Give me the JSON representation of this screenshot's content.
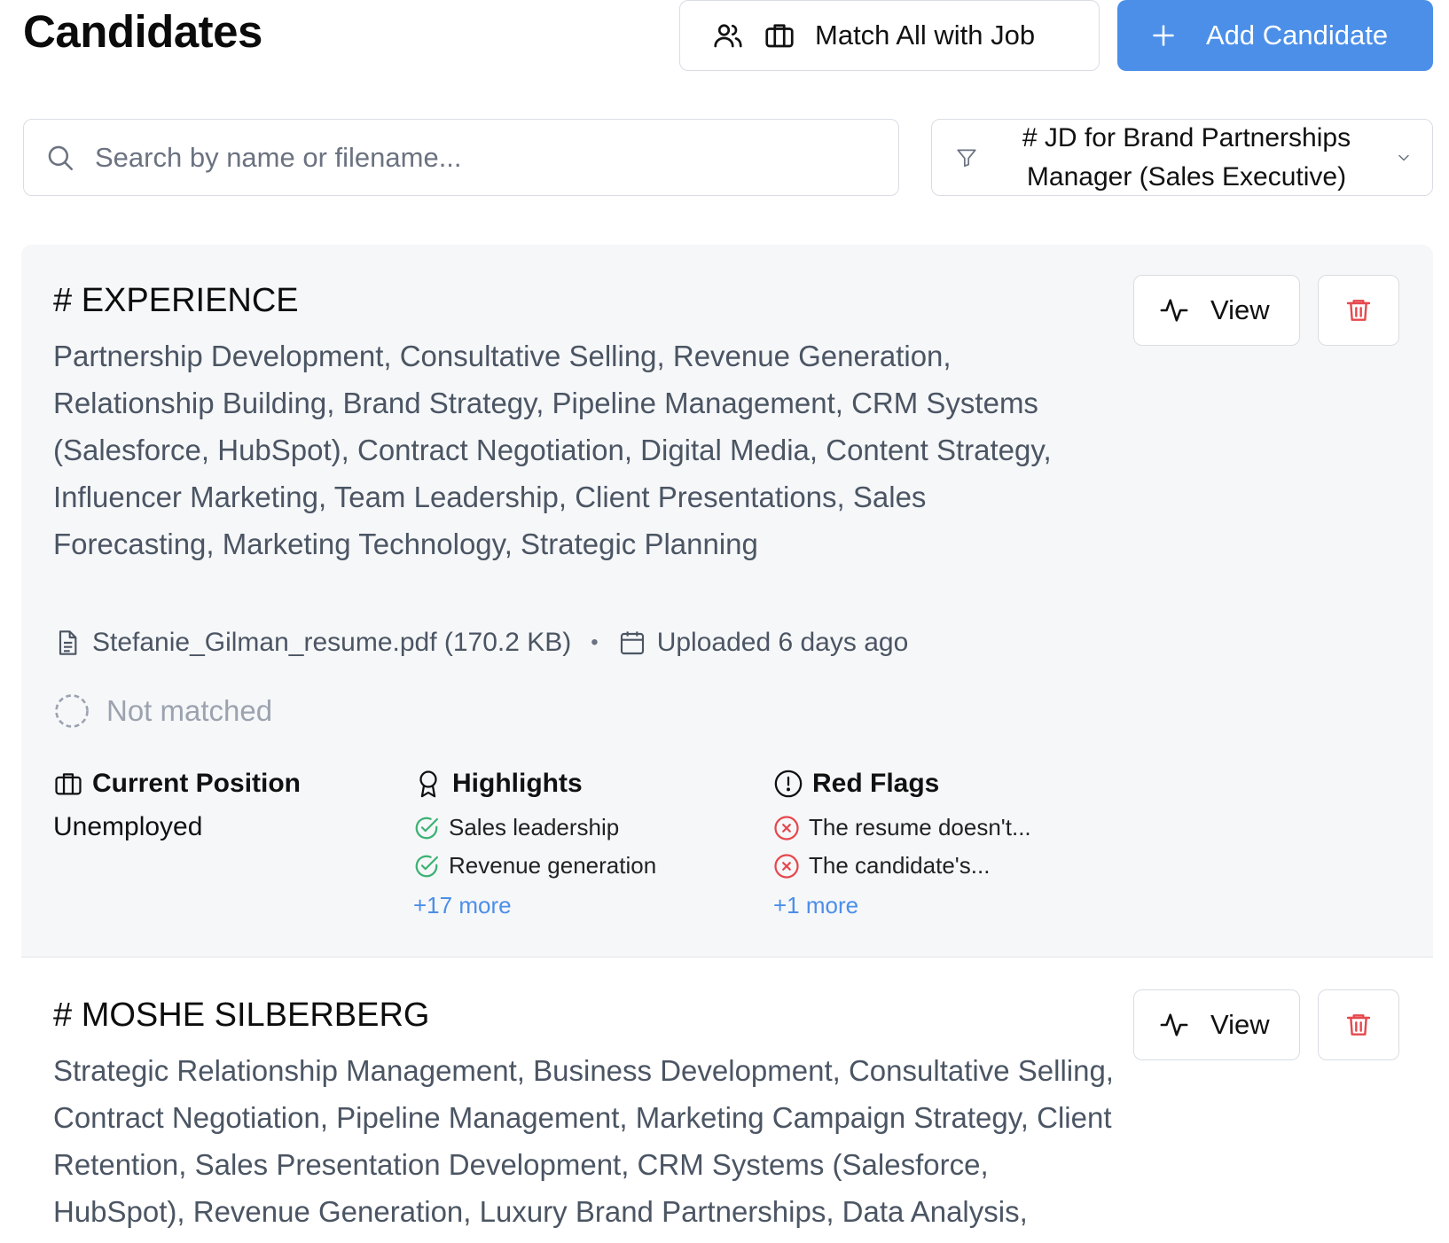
{
  "header": {
    "title": "Candidates",
    "match_all_label": "Match All with Job",
    "add_candidate_label": "Add Candidate"
  },
  "search": {
    "placeholder": "Search by name or filename...",
    "value": ""
  },
  "job_filter": {
    "selected": "# JD for Brand Partnerships Manager (Sales Executive)"
  },
  "colors": {
    "primary": "#4b8fe8",
    "danger": "#e5484d",
    "success": "#3bb273",
    "muted": "#9ca3af"
  },
  "candidates": [
    {
      "name": "# EXPERIENCE",
      "skills": "Partnership Development, Consultative Selling, Revenue Generation, Relationship Building, Brand Strategy, Pipeline Management, CRM Systems (Salesforce, HubSpot), Contract Negotiation, Digital Media, Content Strategy, Influencer Marketing, Team Leadership, Client Presentations, Sales Forecasting, Marketing Technology, Strategic Planning",
      "file": "Stefanie_Gilman_resume.pdf (170.2 KB)",
      "uploaded": "Uploaded 6 days ago",
      "match_status": "Not matched",
      "view_label": "View",
      "current_position_title": "Current Position",
      "current_position": "Unemployed",
      "highlights_title": "Highlights",
      "highlights": [
        "Sales leadership",
        "Revenue generation"
      ],
      "highlights_more": "+17 more",
      "red_flags_title": "Red Flags",
      "red_flags": [
        "The resume doesn't...",
        "The candidate's..."
      ],
      "red_flags_more": "+1 more"
    },
    {
      "name": "# MOSHE SILBERBERG",
      "skills": "Strategic Relationship Management, Business Development, Consultative Selling, Contract Negotiation, Pipeline Management, Marketing Campaign Strategy, Client Retention, Sales Presentation Development, CRM Systems (Salesforce, HubSpot), Revenue Generation, Luxury Brand Partnerships, Data Analysis, Market Research, Strategic Planning",
      "view_label": "View"
    }
  ]
}
